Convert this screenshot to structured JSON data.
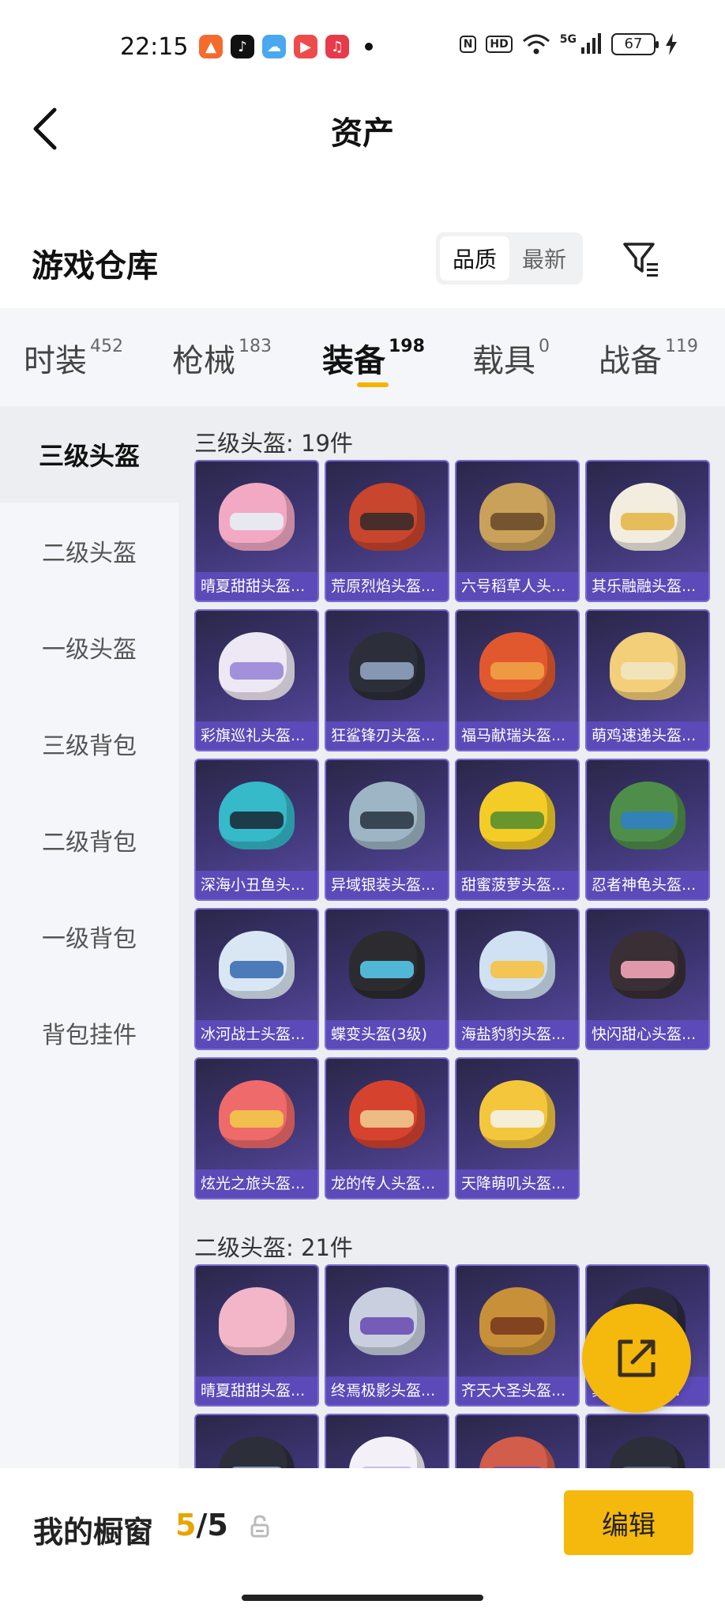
{
  "status_bar": {
    "time": "22:15",
    "battery": "67",
    "network": "5G",
    "hd_label": "HD",
    "nfc_label": "N"
  },
  "header": {
    "title": "资产",
    "back_icon": "chevron-left-icon"
  },
  "warehouse": {
    "title": "游戏仓库",
    "sort_options": [
      "品质",
      "最新"
    ],
    "active_sort": "品质",
    "filter_icon": "filter-icon"
  },
  "category_tabs": [
    {
      "label": "时装",
      "count": "452"
    },
    {
      "label": "枪械",
      "count": "183"
    },
    {
      "label": "装备",
      "count": "198",
      "active": true
    },
    {
      "label": "载具",
      "count": "0"
    },
    {
      "label": "战备",
      "count": "119"
    }
  ],
  "side_nav": [
    {
      "label": "三级头盔",
      "active": true
    },
    {
      "label": "二级头盔"
    },
    {
      "label": "一级头盔"
    },
    {
      "label": "三级背包"
    },
    {
      "label": "二级背包"
    },
    {
      "label": "一级背包"
    },
    {
      "label": "背包挂件"
    }
  ],
  "sections": [
    {
      "title": "三级头盔: 19件",
      "items": [
        {
          "name": "晴夏甜甜头盔...",
          "color": "#f2a9c4",
          "visor": "#e7eef5"
        },
        {
          "name": "荒原烈焰头盔...",
          "color": "#c8452e",
          "visor": "#3a2a2a"
        },
        {
          "name": "六号稻草人头...",
          "color": "#c9a15a",
          "visor": "#6b4d2a"
        },
        {
          "name": "其乐融融头盔...",
          "color": "#f3ede0",
          "visor": "#e4b84a"
        },
        {
          "name": "彩旗巡礼头盔...",
          "color": "#eee8f5",
          "visor": "#9a86d8"
        },
        {
          "name": "狂鲨锋刃头盔...",
          "color": "#2c2f3a",
          "visor": "#8fa3c0"
        },
        {
          "name": "福马献瑞头盔...",
          "color": "#e2582e",
          "visor": "#f0a246"
        },
        {
          "name": "萌鸡速递头盔...",
          "color": "#f3cf7a",
          "visor": "#f1e6c2"
        },
        {
          "name": "深海小丑鱼头...",
          "color": "#36b9c8",
          "visor": "#1b2f3c"
        },
        {
          "name": "异域银装头盔...",
          "color": "#9db5c4",
          "visor": "#2d3a48"
        },
        {
          "name": "甜蜜菠萝头盔...",
          "color": "#f3cc28",
          "visor": "#5a8f2e"
        },
        {
          "name": "忍者神龟头盔...",
          "color": "#4f8e4a",
          "visor": "#2f7fc3"
        },
        {
          "name": "冰河战士头盔...",
          "color": "#d9e7f5",
          "visor": "#3b6fb2"
        },
        {
          "name": "蝶变头盔(3级)",
          "color": "#2c2c30",
          "visor": "#56c7e8"
        },
        {
          "name": "海盐豹豹头盔...",
          "color": "#cfe1f2",
          "visor": "#f5c242"
        },
        {
          "name": "快闪甜心头盔...",
          "color": "#3a2f35",
          "visor": "#f3a5b8"
        },
        {
          "name": "炫光之旅头盔...",
          "color": "#ef6a6a",
          "visor": "#f2c84a"
        },
        {
          "name": "龙的传人头盔...",
          "color": "#d5432f",
          "visor": "#f0c98e"
        },
        {
          "name": "天降萌叽头盔...",
          "color": "#f4c63c",
          "visor": "#f4f2e8"
        }
      ]
    },
    {
      "title": "二级头盔: 21件",
      "items": [
        {
          "name": "晴夏甜甜头盔...",
          "color": "#f2b6c8",
          "visor": "#f2b6c8"
        },
        {
          "name": "终焉极影头盔...",
          "color": "#c9cfdf",
          "visor": "#6a4fb3"
        },
        {
          "name": "齐天大圣头盔...",
          "color": "#c9903a",
          "visor": "#7a3b1e"
        },
        {
          "name": "真武...头盔...",
          "color": "#2b2940",
          "visor": "#3a3560"
        },
        {
          "name": "",
          "color": "#2c2f3a",
          "visor": "#8fa3c0"
        },
        {
          "name": "",
          "color": "#f3f0f7",
          "visor": "#c3b6e8"
        },
        {
          "name": "",
          "color": "#d25d4a",
          "visor": "#6a4fb3"
        },
        {
          "name": "",
          "color": "#2c2f3a",
          "visor": "#5d6b7a"
        }
      ]
    }
  ],
  "share_button": {
    "icon": "share-external-icon"
  },
  "showcase": {
    "label": "我的橱窗",
    "current": "5",
    "separator": "/",
    "total": "5",
    "lock_icon": "lock-icon",
    "edit_label": "编辑"
  }
}
